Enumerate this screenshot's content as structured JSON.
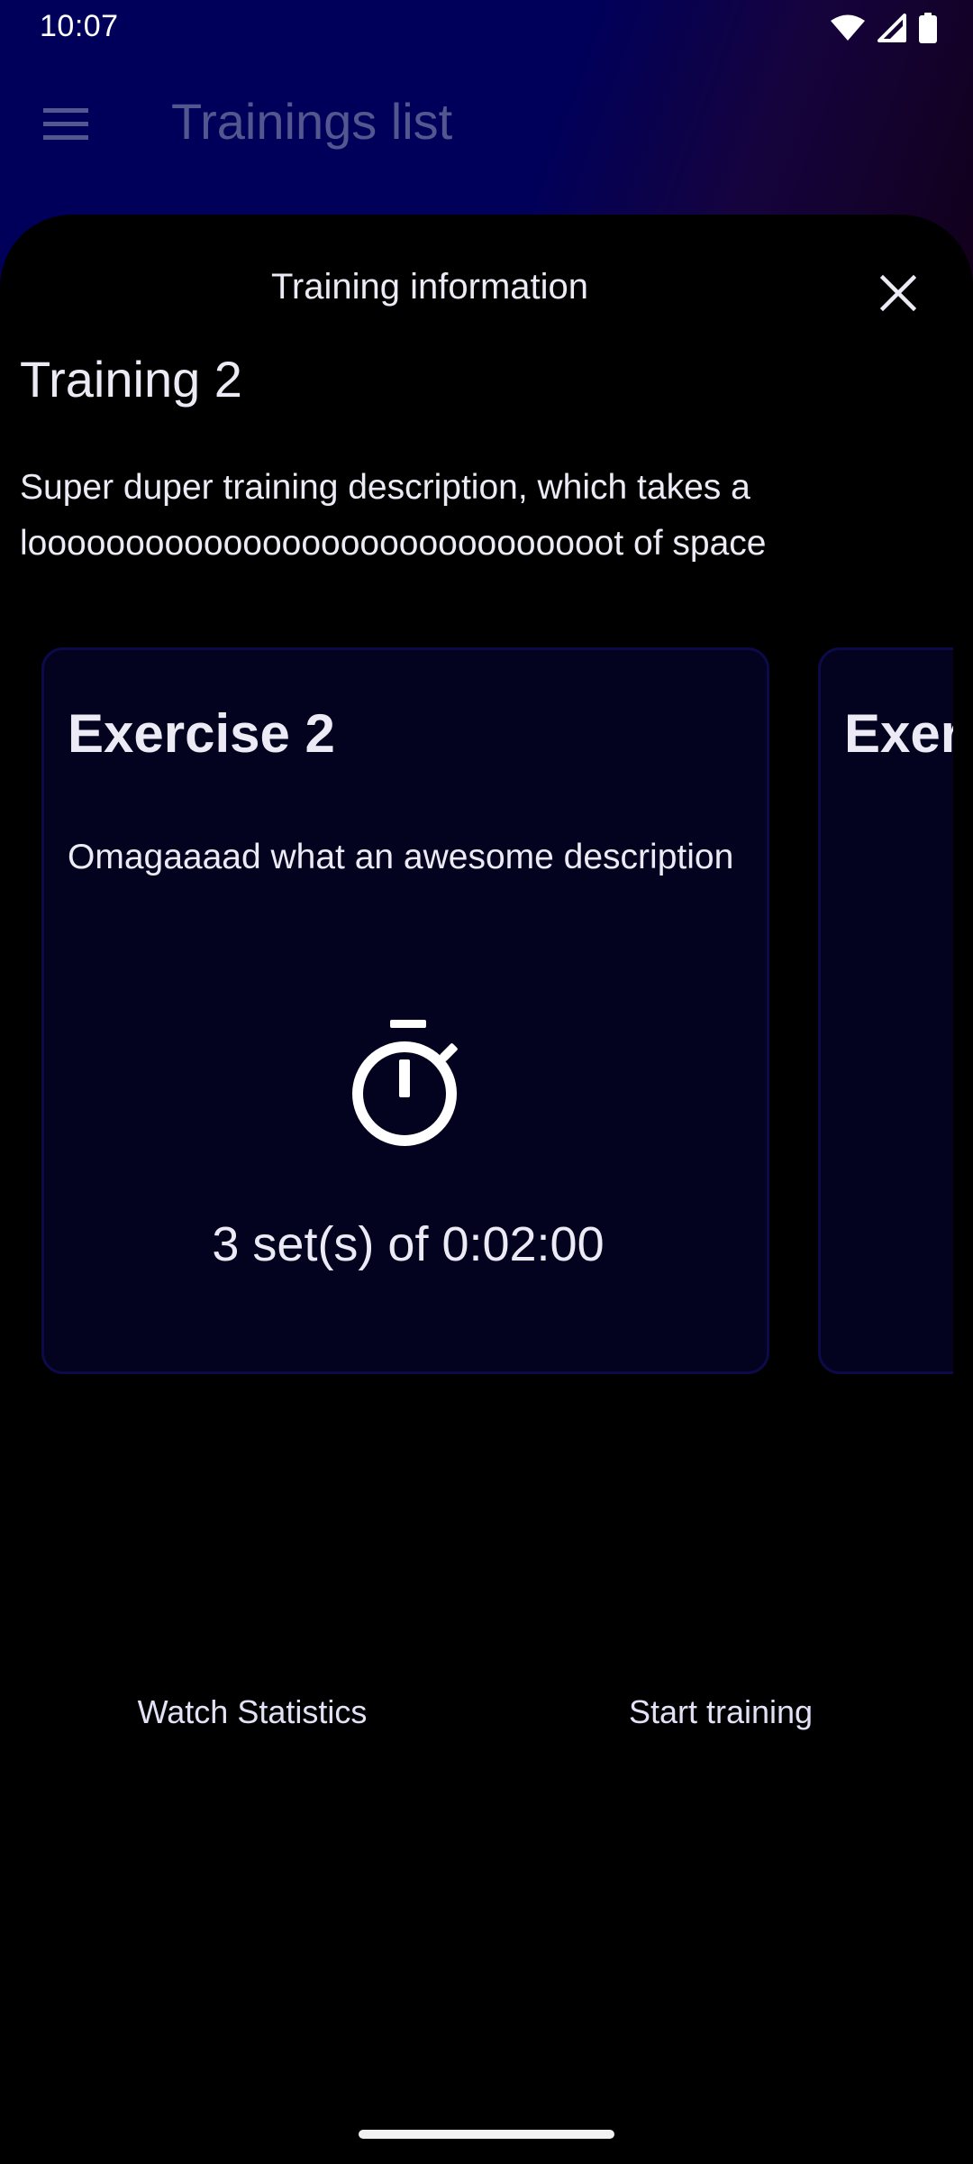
{
  "status_bar": {
    "time": "10:07",
    "icons": [
      "wifi-icon",
      "signal-icon",
      "battery-icon"
    ]
  },
  "app_bar": {
    "menu_icon": "menu-icon",
    "title": "Trainings list"
  },
  "sheet": {
    "title": "Training information",
    "close_icon": "close-icon",
    "training_name": "Training 2",
    "training_description": "Super duper training description, which takes a loooooooooooooooooooooooooooooot of space"
  },
  "exercises": [
    {
      "title": "Exercise 2",
      "description": "Omagaaaad what an awesome description",
      "icon": "timer-icon",
      "sets_label": "3 set(s) of 0:02:00"
    },
    {
      "title": "Exercise"
    }
  ],
  "actions": {
    "watch_statistics": "Watch Statistics",
    "start_training": "Start training"
  },
  "colors": {
    "app_bar_background": "#00005a",
    "card_background": "#03021f",
    "card_border": "#0d0a4a",
    "text": "#ecebf5",
    "muted_title": "#54578f"
  }
}
